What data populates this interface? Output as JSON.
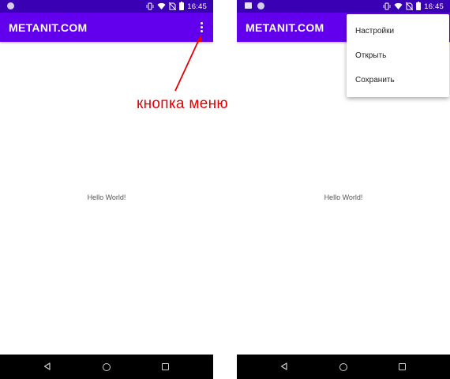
{
  "left_screen": {
    "status_bar": {
      "time": "16:45"
    },
    "app_bar": {
      "title": "METANIT.COM"
    },
    "content": {
      "text": "Hello World!"
    }
  },
  "right_screen": {
    "status_bar": {
      "time": "16:45"
    },
    "app_bar": {
      "title": "METANIT.COM"
    },
    "content": {
      "text": "Hello World!"
    },
    "popup_menu": {
      "items": [
        {
          "label": "Настройки"
        },
        {
          "label": "Открыть"
        },
        {
          "label": "Сохранить"
        }
      ]
    }
  },
  "annotation": {
    "label": "кнопка меню",
    "color": "#e60000"
  },
  "colors": {
    "app_bar": "#6200ee",
    "status_bar": "#3a00b3",
    "nav_bar": "#000000"
  },
  "icons": {
    "status": [
      "vibrate-icon",
      "wifi-icon",
      "no-sim-icon",
      "battery-icon"
    ],
    "nav": [
      "back-icon",
      "home-icon",
      "recents-icon"
    ],
    "overflow": "overflow-menu-icon"
  }
}
